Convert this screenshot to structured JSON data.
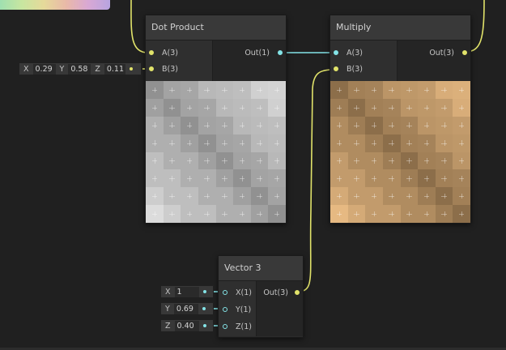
{
  "nodes": {
    "dot_product": {
      "title": "Dot Product",
      "inputs": [
        "A(3)",
        "B(3)"
      ],
      "output": "Out(1)"
    },
    "multiply": {
      "title": "Multiply",
      "inputs": [
        "A(3)",
        "B(3)"
      ],
      "output": "Out(3)"
    },
    "vector3": {
      "title": "Vector 3",
      "inputs": [
        "X(1)",
        "Y(1)",
        "Z(1)"
      ],
      "output": "Out(3)"
    }
  },
  "dot_b_field": {
    "x_label": "X",
    "x_value": "0.29",
    "y_label": "Y",
    "y_value": "0.58",
    "z_label": "Z",
    "z_value": "0.11"
  },
  "vector3_fields": [
    {
      "label": "X",
      "value": "1"
    },
    {
      "label": "Y",
      "value": "0.69"
    },
    {
      "label": "Z",
      "value": "0.40"
    }
  ],
  "colors": {
    "vector3_wire": "#e1e36a",
    "float_wire": "#84e4e7"
  }
}
